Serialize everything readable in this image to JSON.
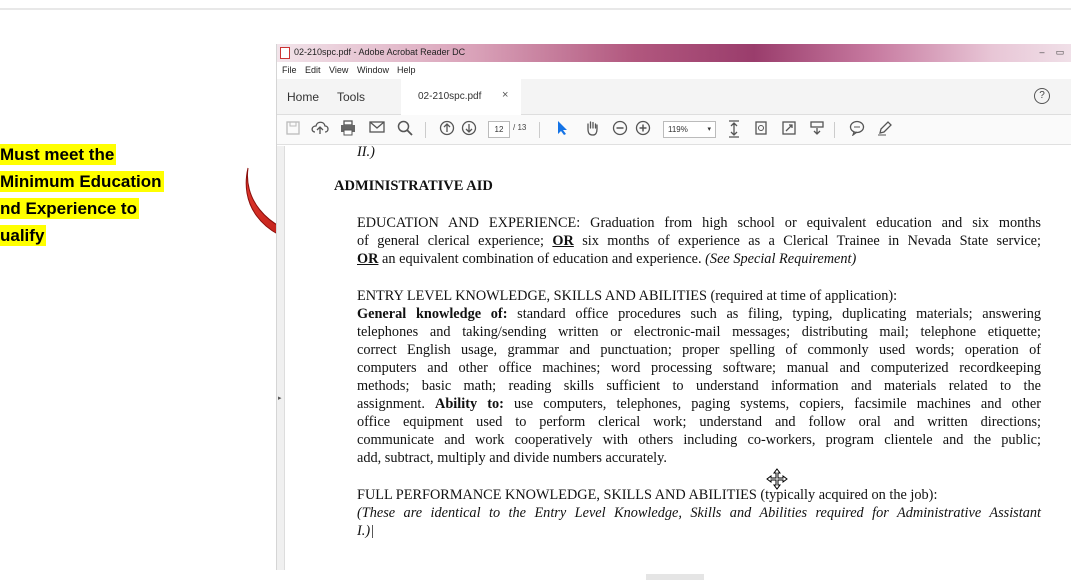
{
  "callout": {
    "lines": [
      "Must meet the",
      "Minimum Education",
      "and Experience to",
      "Qualify"
    ],
    "visible_lines": [
      "Must meet the",
      "Minimum Education",
      "nd Experience to",
      "ualify"
    ],
    "highlight_color": "#ffff00",
    "arrow_color": "#cc1f1a"
  },
  "window": {
    "title": "02-210spc.pdf - Adobe Acrobat Reader DC",
    "controls": [
      "–",
      "▭"
    ]
  },
  "menu": [
    "File",
    "Edit",
    "View",
    "Window",
    "Help"
  ],
  "tabs": {
    "home": "Home",
    "tools": "Tools",
    "document": "02-210spc.pdf",
    "close": "×",
    "help": "?"
  },
  "toolbar": {
    "icons": [
      "save-icon",
      "upload-icon",
      "print-icon",
      "email-icon",
      "search-icon",
      "page-up-icon",
      "page-down-icon",
      "select-arrow-icon",
      "hand-icon",
      "zoom-out-icon",
      "zoom-in-icon",
      "fit-page-icon",
      "rotate-icon",
      "fullscreen-icon",
      "scroll-mode-icon",
      "comment-icon",
      "pen-icon"
    ],
    "page_current": "12",
    "page_total": "/ 13",
    "zoom": "119%"
  },
  "document": {
    "top_fragment": "II.)",
    "heading": "ADMINISTRATIVE AID",
    "edu_lines": [
      "EDUCATION AND EXPERIENCE:  Graduation from high school or equivalent education and six months",
      [
        "of general clerical experience; ",
        "OR",
        " six months of experience as a Clerical Trainee in Nevada State service;"
      ],
      [
        "OR",
        " an equivalent combination of education and experience.  ",
        "(See Special Requirement)"
      ]
    ],
    "entry_heading": "ENTRY LEVEL KNOWLEDGE, SKILLS AND ABILITIES (required at time of application):",
    "entry_lines": [
      [
        "General knowledge of:",
        "  standard office procedures such as filing, typing, duplicating materials; answering"
      ],
      "telephones and taking/sending written or electronic-mail messages; distributing mail; telephone etiquette;",
      "correct English usage, grammar and punctuation; proper spelling of commonly used words; operation of",
      "computers and other office machines; word processing software; manual and computerized recordkeeping",
      "methods; basic math; reading skills sufficient to understand information and materials related to the",
      [
        "assignment.  ",
        "Ability to:",
        "  use computers, telephones, paging systems, copiers, facsimile machines and other"
      ],
      "office equipment used to perform clerical work; understand and follow oral and written directions;",
      "communicate and work cooperatively with others including co-workers, program clientele and the public;",
      "add, subtract, multiply and divide numbers accurately."
    ],
    "full_heading": "FULL PERFORMANCE KNOWLEDGE, SKILLS AND ABILITIES (typically acquired on the job):",
    "full_lines": [
      "(These are identical to the Entry Level Knowledge, Skills and Abilities required for Administrative Assistant",
      "I.)|"
    ]
  }
}
